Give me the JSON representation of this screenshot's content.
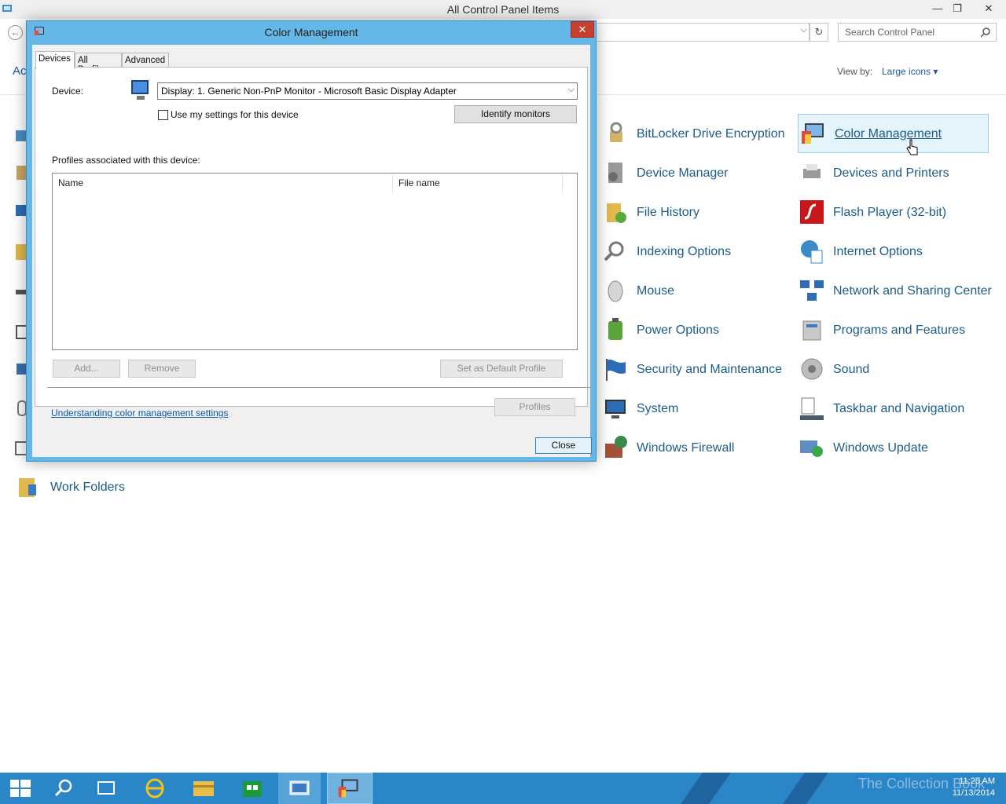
{
  "window": {
    "title": "All Control Panel Items",
    "minimize": "—",
    "maximize": "❐",
    "close": "✕"
  },
  "address": {
    "search_placeholder": "Search Control Panel",
    "breadcrumb_fragment": "Ac"
  },
  "view": {
    "view_by_label": "View by:",
    "view_by_value": "Large icons ▾"
  },
  "items": [
    {
      "label": "BitLocker Drive Encryption",
      "icon": "bitlocker-icon"
    },
    {
      "label": "Color Management",
      "icon": "color-management-icon",
      "selected": true
    },
    {
      "label": "Device Manager",
      "icon": "device-manager-icon"
    },
    {
      "label": "Devices and Printers",
      "icon": "devices-printers-icon"
    },
    {
      "label": "File History",
      "icon": "file-history-icon"
    },
    {
      "label": "Flash Player (32-bit)",
      "icon": "flash-player-icon"
    },
    {
      "label": "Indexing Options",
      "icon": "indexing-options-icon"
    },
    {
      "label": "Internet Options",
      "icon": "internet-options-icon"
    },
    {
      "label": "Mouse",
      "icon": "mouse-icon"
    },
    {
      "label": "Network and Sharing Center",
      "icon": "network-sharing-icon"
    },
    {
      "label": "Power Options",
      "icon": "power-options-icon"
    },
    {
      "label": "Programs and Features",
      "icon": "programs-features-icon"
    },
    {
      "label": "Security and Maintenance",
      "icon": "security-maintenance-icon"
    },
    {
      "label": "Sound",
      "icon": "sound-icon"
    },
    {
      "label": "System",
      "icon": "system-icon"
    },
    {
      "label": "Taskbar and Navigation",
      "icon": "taskbar-navigation-icon"
    },
    {
      "label": "Windows Firewall",
      "icon": "windows-firewall-icon"
    },
    {
      "label": "Windows Update",
      "icon": "windows-update-icon"
    },
    {
      "label": "Work Folders",
      "icon": "work-folders-icon"
    }
  ],
  "dialog": {
    "title": "Color Management",
    "close_x": "✕",
    "tabs": [
      "Devices",
      "All Profiles",
      "Advanced"
    ],
    "device_label": "Device:",
    "device_value": "Display: 1. Generic Non-PnP Monitor - Microsoft Basic Display Adapter",
    "use_settings_label": "Use my settings for this device",
    "identify_button": "Identify monitors",
    "profiles_label": "Profiles associated with this device:",
    "columns": [
      "Name",
      "File name"
    ],
    "add_button": "Add...",
    "remove_button": "Remove",
    "set_default_button": "Set as Default Profile",
    "link": "Understanding color management settings",
    "profiles_button": "Profiles",
    "close_button": "Close"
  },
  "taskbar": {
    "time": "11:25 AM",
    "date": "11/13/2014",
    "watermark": "The Collection Book"
  },
  "colors": {
    "dialog_frame": "#64b7e6",
    "taskbar": "#2a86c6",
    "link": "#1c5c8a"
  }
}
